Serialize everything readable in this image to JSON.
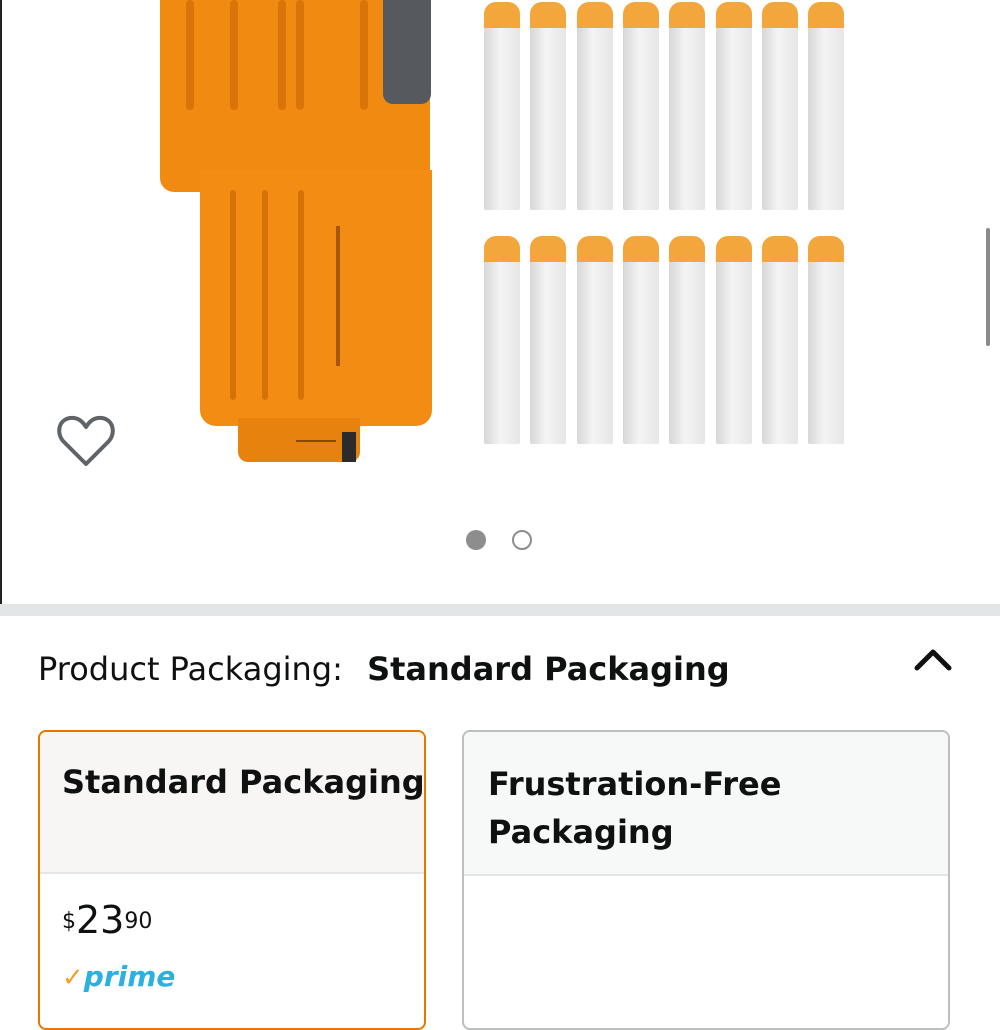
{
  "product_image": {
    "description_icons": [
      "blaster-magazine",
      "foam-darts"
    ]
  },
  "favorite": {
    "icon": "heart-outline-icon"
  },
  "carousel": {
    "page_count": 2,
    "active_index": 0
  },
  "packaging": {
    "label": "Product Packaging:",
    "selected_value": "Standard Packaging",
    "collapse_icon": "chevron-up-icon",
    "options": [
      {
        "title": "Standard Packaging",
        "price_symbol": "$",
        "price_whole": "23",
        "price_fraction": "90",
        "prime_label": "prime",
        "selected": true
      },
      {
        "title": "Frustration-Free Packaging",
        "selected": false
      }
    ]
  },
  "colors": {
    "selected_border": "#e77600",
    "unselected_border": "#bbbfbf",
    "prime_blue": "#2bb0e0",
    "prime_check": "#f0a32b",
    "divider": "#e3e6e6"
  }
}
